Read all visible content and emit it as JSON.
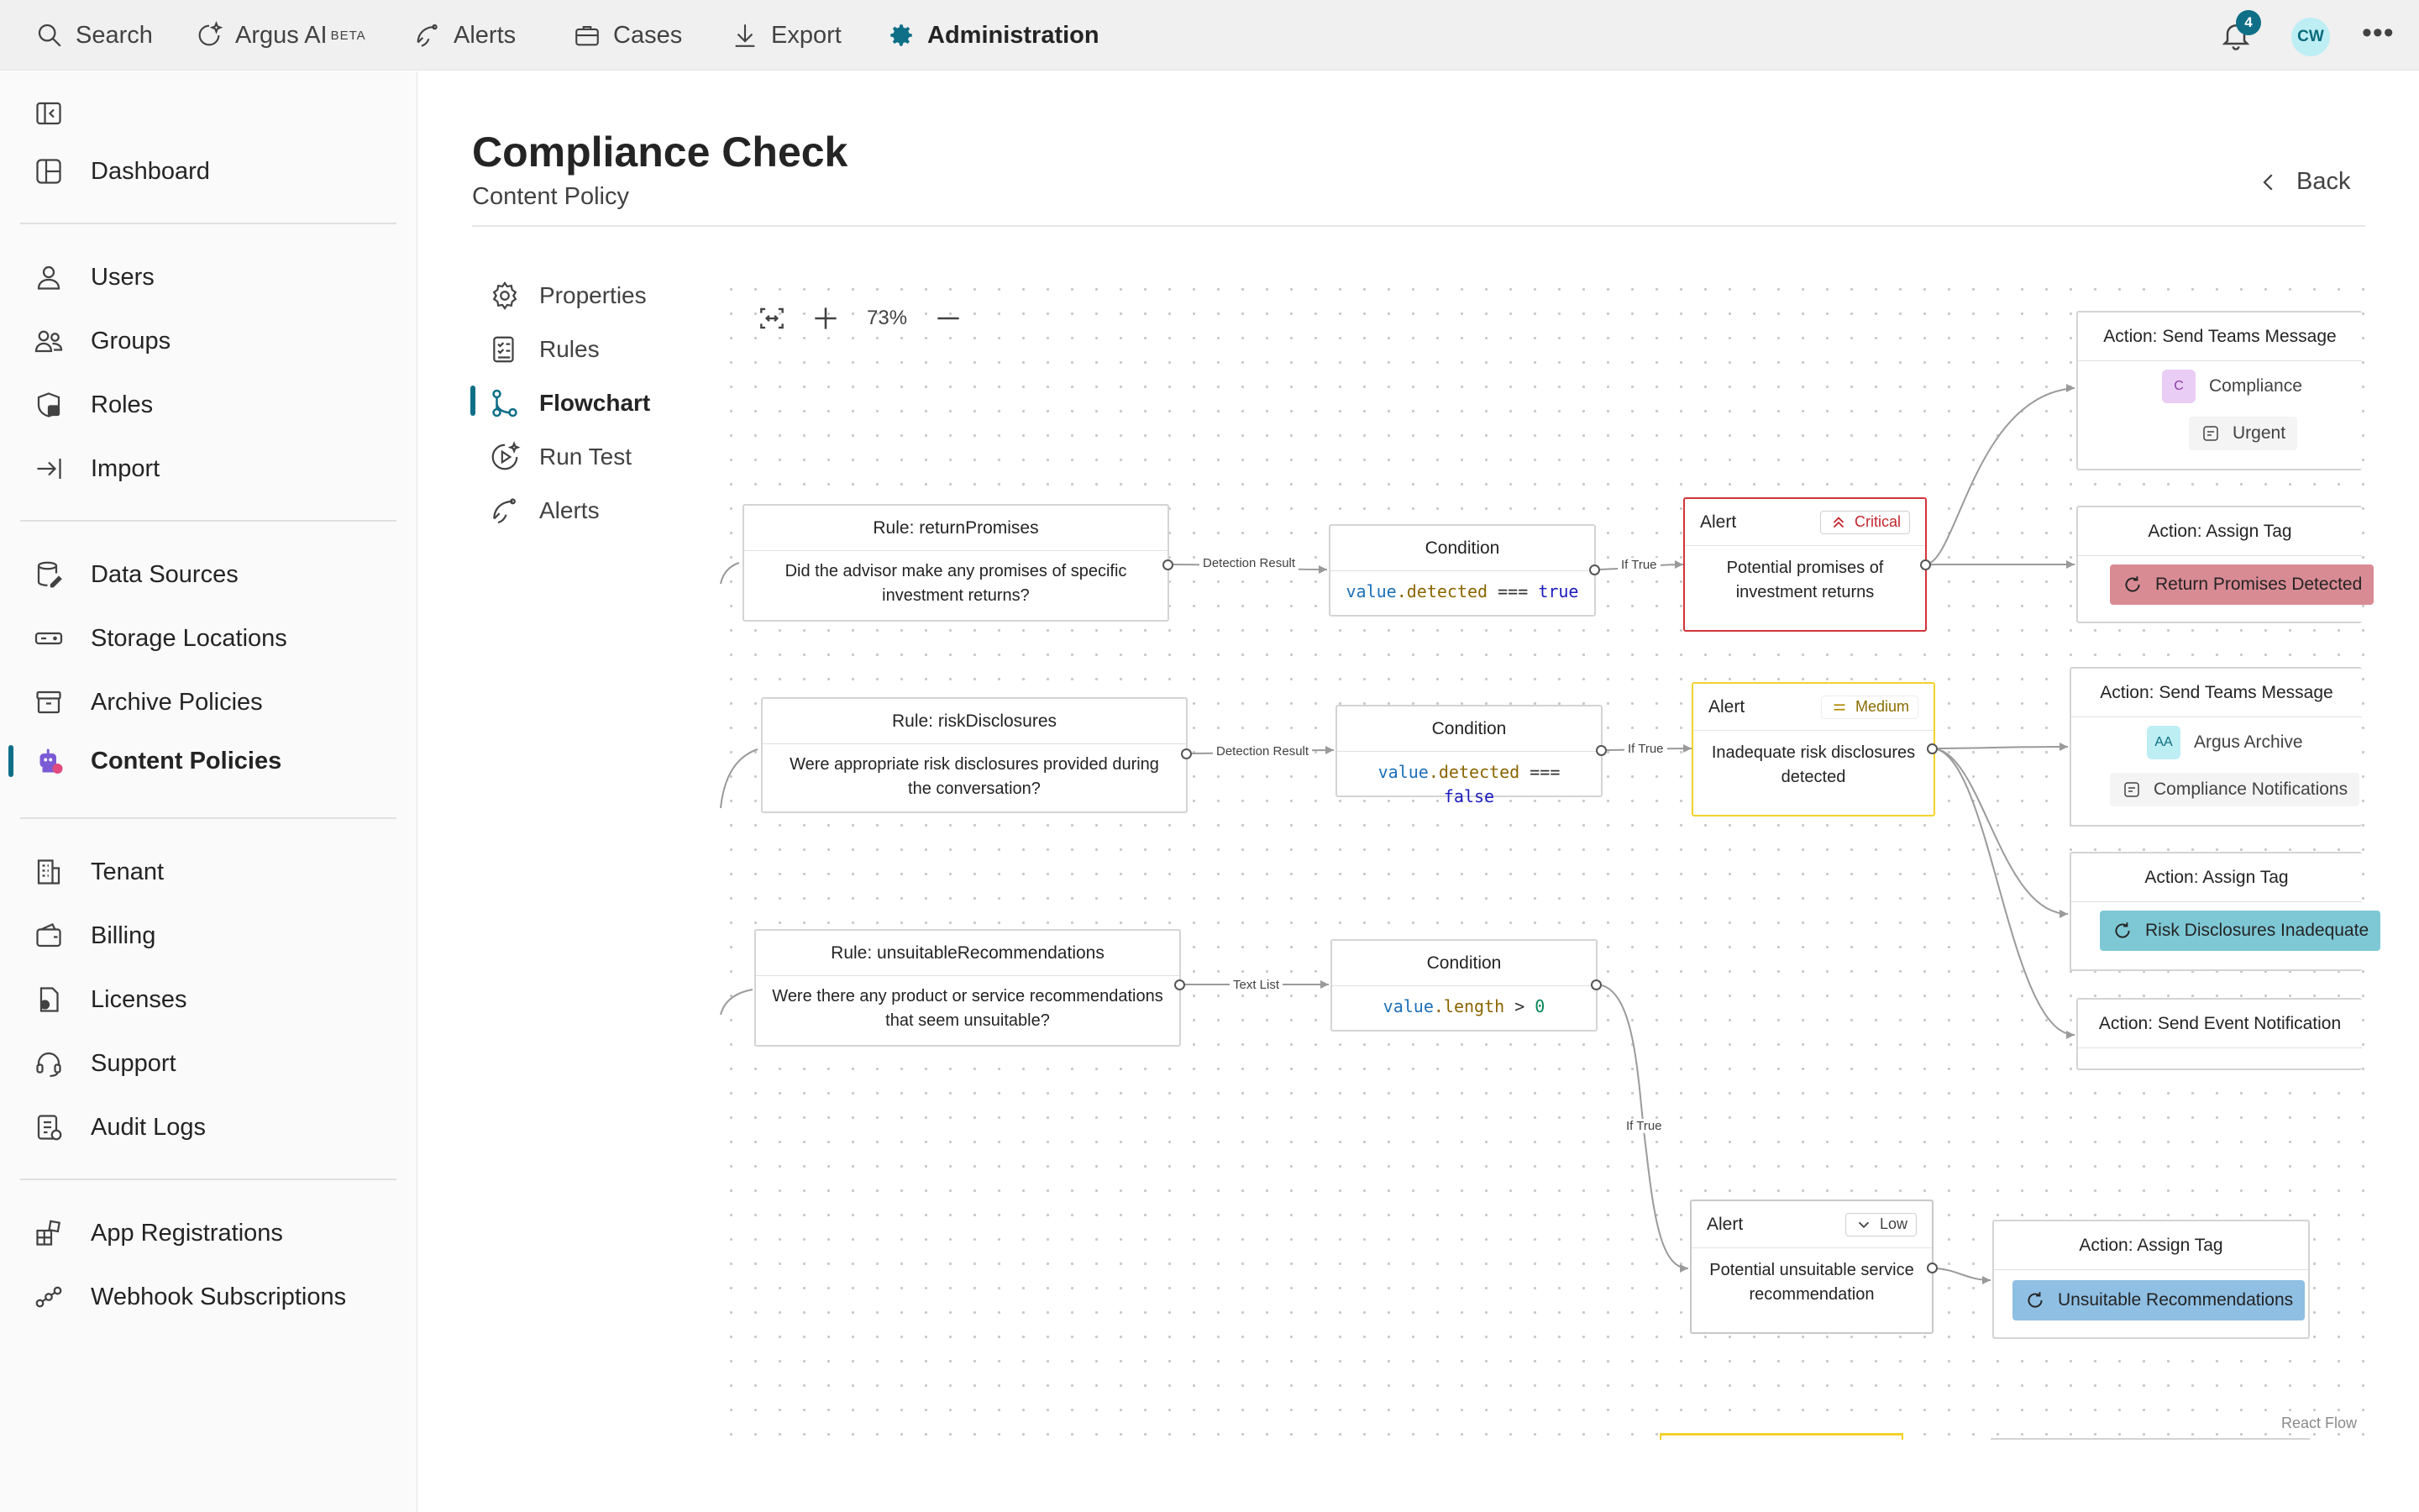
{
  "topbar": {
    "search": "Search",
    "argus_ai": "Argus AI",
    "beta": "BETA",
    "alerts": "Alerts",
    "cases": "Cases",
    "export": "Export",
    "administration": "Administration",
    "notification_count": "4",
    "avatar_initials": "CW",
    "more": "•••"
  },
  "sidebar": {
    "dashboard": "Dashboard",
    "users": "Users",
    "groups": "Groups",
    "roles": "Roles",
    "import": "Import",
    "data_sources": "Data Sources",
    "storage_locations": "Storage Locations",
    "archive_policies": "Archive Policies",
    "content_policies": "Content Policies",
    "tenant": "Tenant",
    "billing": "Billing",
    "licenses": "Licenses",
    "support": "Support",
    "audit_logs": "Audit Logs",
    "app_registrations": "App Registrations",
    "webhook_subscriptions": "Webhook Subscriptions"
  },
  "header": {
    "title": "Compliance Check",
    "subtitle": "Content Policy",
    "back": "Back"
  },
  "subnav": {
    "properties": "Properties",
    "rules": "Rules",
    "flowchart": "Flowchart",
    "run_test": "Run Test",
    "alerts": "Alerts"
  },
  "controls": {
    "zoom": "73%"
  },
  "flow": {
    "rule1": {
      "title": "Rule: returnPromises",
      "text": "Did the advisor make any promises of specific investment returns?"
    },
    "rule2": {
      "title": "Rule: riskDisclosures",
      "text": "Were appropriate risk disclosures provided during the conversation?"
    },
    "rule3": {
      "title": "Rule: unsuitableRecommendations",
      "text": "Were there any product or service recommendations that seem unsuitable?"
    },
    "edge_detection1": "Detection Result",
    "edge_detection2": "Detection Result",
    "edge_textlist": "Text List",
    "edge_iftrue1": "If True",
    "edge_iftrue2": "If True",
    "edge_iftrue3": "If True",
    "cond1": {
      "title": "Condition",
      "var": "value",
      "prop": ".detected",
      "op": " === ",
      "val": "true"
    },
    "cond2": {
      "title": "Condition",
      "var": "value",
      "prop": ".detected",
      "op": " === ",
      "val": "false"
    },
    "cond3": {
      "title": "Condition",
      "var": "value",
      "prop": ".length",
      "op": " > ",
      "val": "0"
    },
    "alert1": {
      "title": "Alert",
      "severity": "Critical",
      "text": "Potential promises of investment returns"
    },
    "alert2": {
      "title": "Alert",
      "severity": "Medium",
      "text": "Inadequate risk disclosures detected"
    },
    "alert3": {
      "title": "Alert",
      "severity": "Low",
      "text": "Potential unsuitable service recommendation"
    },
    "action1": {
      "title": "Action: Send Teams Message",
      "avatar": "C",
      "team": "Compliance",
      "channel": "Urgent"
    },
    "action2": {
      "title": "Action: Assign Tag",
      "tag": "Return Promises Detected"
    },
    "action3": {
      "title": "Action: Send Teams Message",
      "avatar": "AA",
      "team": "Argus Archive",
      "channel": "Compliance Notifications"
    },
    "action4": {
      "title": "Action: Assign Tag",
      "tag": "Risk Disclosures Inadequate"
    },
    "action5": {
      "title": "Action: Send Event Notification"
    },
    "action6": {
      "title": "Action: Assign Tag",
      "tag": "Unsuitable Recommendations"
    },
    "watermark": "React Flow"
  },
  "colors": {
    "accent": "#0f6f87",
    "critical_border": "#d13438",
    "critical_tag": "#d98b94",
    "medium_border": "#f2d22c",
    "teal_tag": "#7ec8d6",
    "blue_tag": "#8fbfe3"
  }
}
